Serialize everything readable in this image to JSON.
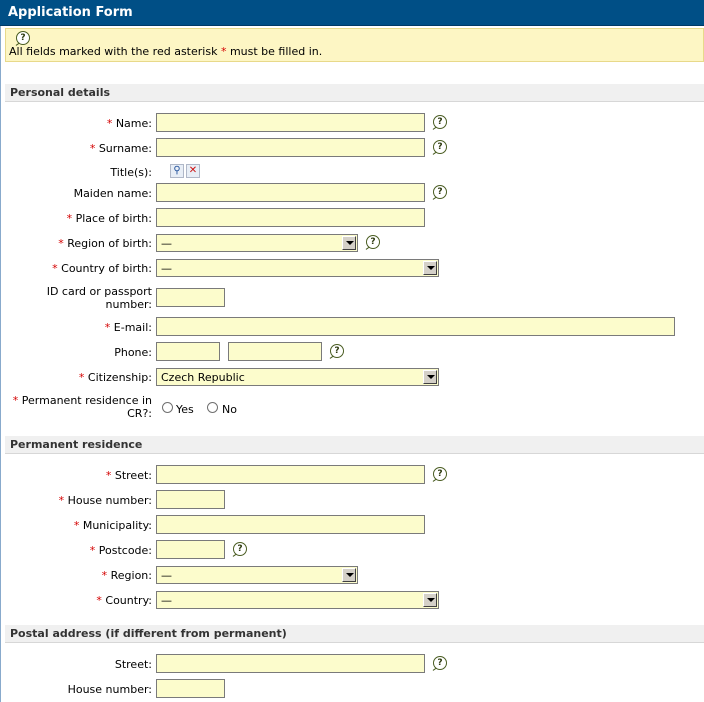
{
  "form": {
    "title": "Application Form",
    "notice": {
      "text_before": "All fields marked with the red asterisk ",
      "asterisk": "*",
      "text_after": " must be filled in."
    }
  },
  "sections": {
    "personal": "Personal details",
    "permanent": "Permanent residence",
    "postal": "Postal address (if different from permanent)"
  },
  "personal": {
    "name": "Name:",
    "surname": "Surname:",
    "titles": "Title(s):",
    "maiden": "Maiden name:",
    "place_of_birth": "Place of birth:",
    "region_of_birth": "Region of birth:",
    "region_of_birth_value": "—",
    "country_of_birth": "Country of birth:",
    "country_of_birth_value": "—",
    "id_line1": "ID card or passport",
    "id_line2": "number:",
    "email": "E-mail:",
    "phone": "Phone:",
    "citizenship": "Citizenship:",
    "citizenship_value": "Czech Republic",
    "perm_res_line1": "Permanent residence in",
    "perm_res_line2": "CR?:",
    "yes": "Yes",
    "no": "No"
  },
  "permanent": {
    "street": "Street:",
    "house_number": "House number:",
    "municipality": "Municipality:",
    "postcode": "Postcode:",
    "region": "Region:",
    "region_value": "—",
    "country": "Country:",
    "country_value": "—"
  },
  "postal": {
    "street": "Street:",
    "house_number": "House number:"
  },
  "icons": {
    "help": "help-icon",
    "search": "search-icon",
    "delete": "delete-icon"
  },
  "colors": {
    "title_bar": "#004f86",
    "input_bg": "#fcfccc",
    "notice_bg": "#fdf6c4",
    "required": "#d40000"
  }
}
